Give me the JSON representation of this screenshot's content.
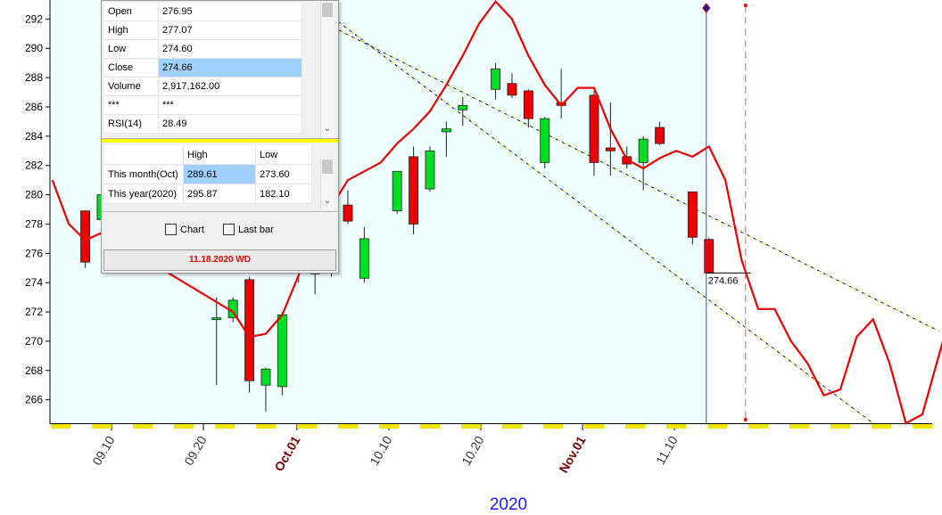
{
  "chart_data": {
    "type": "candlestick",
    "year_label": "2020",
    "y_ticks": [
      266,
      268,
      270,
      272,
      274,
      276,
      278,
      280,
      282,
      284,
      286,
      288,
      290,
      292
    ],
    "ylim": [
      264.4,
      293.3
    ],
    "x_ticks": [
      {
        "label": "09.10",
        "index": 3.6,
        "month": false
      },
      {
        "label": "09.20",
        "index": 9.2,
        "month": false
      },
      {
        "label": "Oct.01",
        "index": 14.9,
        "month": true
      },
      {
        "label": "10.10",
        "index": 20.5,
        "month": false
      },
      {
        "label": "10.20",
        "index": 26.1,
        "month": false
      },
      {
        "label": "Nov.01",
        "index": 32.3,
        "month": true
      },
      {
        "label": "11.10",
        "index": 37.9,
        "month": false
      }
    ],
    "candles": [
      {
        "i": 2,
        "open": 278.9,
        "high": 278.9,
        "low": 275.0,
        "close": 275.4
      },
      {
        "i": 3,
        "open": 278.3,
        "high": 280.2,
        "low": 278.0,
        "close": 280.0
      },
      {
        "i": 10,
        "open": 271.6,
        "high": 273.0,
        "low": 267.0,
        "close": 271.6
      },
      {
        "i": 11,
        "open": 271.6,
        "high": 273.0,
        "low": 271.3,
        "close": 272.8
      },
      {
        "i": 12,
        "open": 274.2,
        "high": 274.4,
        "low": 266.5,
        "close": 267.3
      },
      {
        "i": 13,
        "open": 267.0,
        "high": 268.2,
        "low": 265.2,
        "close": 268.1
      },
      {
        "i": 14,
        "open": 266.9,
        "high": 272.0,
        "low": 266.3,
        "close": 271.8
      },
      {
        "i": 15,
        "open": 275.0,
        "high": 276.0,
        "low": 274.0,
        "close": 275.6
      },
      {
        "i": 16,
        "open": 275.7,
        "high": 276.2,
        "low": 273.2,
        "close": 274.6
      },
      {
        "i": 17,
        "open": 275.1,
        "high": 278.2,
        "low": 274.4,
        "close": 277.5
      },
      {
        "i": 18,
        "open": 279.3,
        "high": 280.3,
        "low": 278.0,
        "close": 278.2
      },
      {
        "i": 19,
        "open": 274.3,
        "high": 277.8,
        "low": 274.0,
        "close": 277.0
      },
      {
        "i": 21,
        "open": 278.9,
        "high": 281.5,
        "low": 278.7,
        "close": 281.6
      },
      {
        "i": 22,
        "open": 282.6,
        "high": 283.3,
        "low": 277.3,
        "close": 278.0
      },
      {
        "i": 23,
        "open": 280.4,
        "high": 283.3,
        "low": 280.2,
        "close": 283.0
      },
      {
        "i": 24,
        "open": 284.3,
        "high": 285.0,
        "low": 282.6,
        "close": 284.5
      },
      {
        "i": 25,
        "open": 285.8,
        "high": 286.7,
        "low": 284.7,
        "close": 286.1
      },
      {
        "i": 27,
        "open": 287.2,
        "high": 289.0,
        "low": 286.5,
        "close": 288.6
      },
      {
        "i": 28,
        "open": 287.6,
        "high": 288.3,
        "low": 286.6,
        "close": 286.8
      },
      {
        "i": 29,
        "open": 287.1,
        "high": 287.2,
        "low": 284.6,
        "close": 285.2
      },
      {
        "i": 30,
        "open": 282.2,
        "high": 285.3,
        "low": 281.8,
        "close": 285.2
      },
      {
        "i": 31,
        "open": 286.3,
        "high": 288.6,
        "low": 285.2,
        "close": 286.1
      },
      {
        "i": 33,
        "open": 286.8,
        "high": 287.1,
        "low": 281.3,
        "close": 282.2
      },
      {
        "i": 34,
        "open": 283.2,
        "high": 286.3,
        "low": 281.3,
        "close": 283.0
      },
      {
        "i": 35,
        "open": 282.6,
        "high": 283.3,
        "low": 281.8,
        "close": 282.1
      },
      {
        "i": 36,
        "open": 282.2,
        "high": 284.0,
        "low": 280.3,
        "close": 283.8
      },
      {
        "i": 37,
        "open": 284.6,
        "high": 285.0,
        "low": 283.4,
        "close": 283.5
      },
      {
        "i": 39,
        "open": 280.2,
        "high": 280.2,
        "low": 276.6,
        "close": 277.1
      },
      {
        "i": 40,
        "open": 276.95,
        "high": 277.07,
        "low": 274.6,
        "close": 274.66
      }
    ],
    "indicator_line": [
      [
        0,
        281.0
      ],
      [
        1,
        278.0
      ],
      [
        2,
        276.9
      ],
      [
        3,
        277.4
      ],
      [
        11,
        272.0
      ],
      [
        12,
        270.3
      ],
      [
        13,
        270.5
      ],
      [
        14,
        271.8
      ],
      [
        15,
        274.5
      ],
      [
        16,
        278.0
      ],
      [
        17,
        279.2
      ],
      [
        18,
        281.0
      ],
      [
        19,
        281.6
      ],
      [
        20,
        282.2
      ],
      [
        21,
        283.5
      ],
      [
        22,
        284.5
      ],
      [
        23,
        285.7
      ],
      [
        24,
        287.5
      ],
      [
        25,
        289.5
      ],
      [
        26,
        291.7
      ],
      [
        27,
        293.2
      ],
      [
        28,
        292.0
      ],
      [
        29,
        289.5
      ],
      [
        30,
        287.5
      ],
      [
        31,
        286.1
      ],
      [
        32,
        287.3
      ],
      [
        33,
        287.3
      ],
      [
        34,
        284.5
      ],
      [
        35,
        282.4
      ],
      [
        36,
        281.8
      ],
      [
        37,
        282.5
      ],
      [
        38,
        283.0
      ],
      [
        39,
        282.6
      ],
      [
        40,
        283.3
      ],
      [
        41,
        281.0
      ],
      [
        42,
        275.5
      ],
      [
        43,
        272.2
      ],
      [
        44,
        272.2
      ],
      [
        45,
        270.0
      ],
      [
        46,
        268.5
      ],
      [
        47,
        266.3
      ],
      [
        48,
        266.7
      ],
      [
        49,
        270.3
      ],
      [
        50,
        271.5
      ],
      [
        51,
        268.5
      ],
      [
        52,
        264.4
      ],
      [
        53,
        265.0
      ],
      [
        54,
        269.0
      ],
      [
        55,
        273.0
      ],
      [
        56,
        277.5
      ],
      [
        57,
        278.2
      ],
      [
        58,
        277.3
      ],
      [
        59,
        276.8
      ],
      [
        60,
        274.0
      ],
      [
        61,
        272.0
      ],
      [
        62,
        271.5
      ]
    ],
    "channel_upper": [
      [
        12,
        294.3
      ],
      [
        54,
        270.7
      ]
    ],
    "channel_lower": [
      [
        16,
        293.0
      ],
      [
        50,
        264.4
      ]
    ],
    "last_price_label": "274.66",
    "visible_x_range": [
      -0.15,
      53.6
    ]
  },
  "panel": {
    "ohlc_rows": [
      {
        "label": "Open",
        "value": "276.95"
      },
      {
        "label": "High",
        "value": "277.07"
      },
      {
        "label": "Low",
        "value": "274.60"
      },
      {
        "label": "Close",
        "value": "274.66"
      },
      {
        "label": "Volume",
        "value": "2,917,162.00"
      },
      {
        "label": "***",
        "value": "***"
      },
      {
        "label": "RSI(14)",
        "value": "28.49"
      }
    ],
    "period_header": {
      "high": "High",
      "low": "Low"
    },
    "period_rows": [
      {
        "label": "This month(Oct)",
        "high": "289.61",
        "low": "273.60"
      },
      {
        "label": "This year(2020)",
        "high": "295.87",
        "low": "182.10"
      }
    ],
    "chart_checkbox": "Chart",
    "lastbar_checkbox": "Last bar",
    "date_label": "11.18.2020 WD"
  },
  "colors": {
    "plot_bg": "#effeff",
    "up_candle": "#00dd22",
    "down_candle": "#ee0000",
    "indicator": "#ee0000",
    "channel": "#00008b",
    "highlight_cell": "#9fd0ff"
  }
}
